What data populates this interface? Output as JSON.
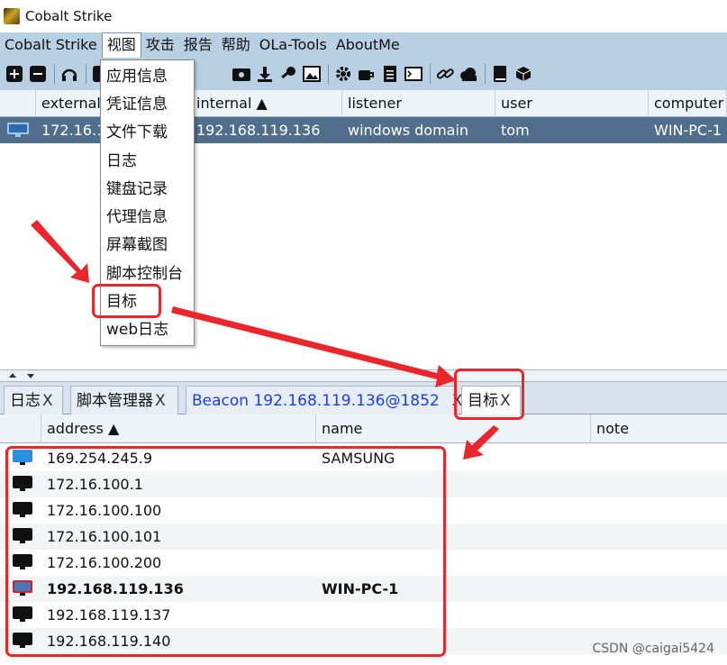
{
  "window": {
    "title": "Cobalt Strike"
  },
  "menubar": {
    "items": [
      "Cobalt Strike",
      "视图",
      "攻击",
      "报告",
      "帮助",
      "OLa-Tools",
      "AboutMe"
    ],
    "active": "视图"
  },
  "toolbar": {
    "icons": [
      "plus-icon",
      "minus-icon",
      "headphones-icon",
      "icon-a",
      "icon-b",
      "screenshot-icon",
      "download-icon",
      "key-icon",
      "image-icon",
      "gear-icon",
      "coffee-icon",
      "document-icon",
      "terminal-icon",
      "link-icon",
      "cloud-icon",
      "book-icon",
      "cube-icon"
    ]
  },
  "view_menu": {
    "items": [
      "应用信息",
      "凭证信息",
      "文件下载",
      "日志",
      "键盘记录",
      "代理信息",
      "屏幕截图",
      "脚本控制台",
      "目标",
      "web日志"
    ],
    "highlighted": "目标"
  },
  "sessions_table": {
    "columns": [
      "external",
      "internal ▲",
      "listener",
      "user",
      "computer"
    ],
    "rows": [
      {
        "external": "172.16.1",
        "internal": "192.168.119.136",
        "listener": "windows domain",
        "user": "tom",
        "computer": "WIN-PC-1"
      }
    ]
  },
  "tabs": [
    {
      "label": "日志",
      "close": "X"
    },
    {
      "label": "脚本管理器",
      "close": "X"
    },
    {
      "label": "Beacon 192.168.119.136@1852",
      "close": "X"
    },
    {
      "label": "目标",
      "close": "X"
    }
  ],
  "targets_table": {
    "columns": [
      "address ▲",
      "name",
      "note"
    ],
    "rows": [
      {
        "address": "169.254.245.9",
        "name": "SAMSUNG",
        "os": "windows"
      },
      {
        "address": "172.16.100.1",
        "name": "",
        "os": "unknown"
      },
      {
        "address": "172.16.100.100",
        "name": "",
        "os": "unknown"
      },
      {
        "address": "172.16.100.101",
        "name": "",
        "os": "unknown"
      },
      {
        "address": "172.16.100.200",
        "name": "",
        "os": "unknown"
      },
      {
        "address": "192.168.119.136",
        "name": "WIN-PC-1",
        "os": "compromised"
      },
      {
        "address": "192.168.119.137",
        "name": "",
        "os": "unknown"
      },
      {
        "address": "192.168.119.140",
        "name": "",
        "os": "unknown"
      }
    ]
  },
  "watermark": "CSDN @caigai5424",
  "colors": {
    "menubar": "#b8cfe4",
    "selected_row": "#516e8c",
    "annotation": "#e8262b",
    "beacon_tab": "#1a3ee0"
  }
}
